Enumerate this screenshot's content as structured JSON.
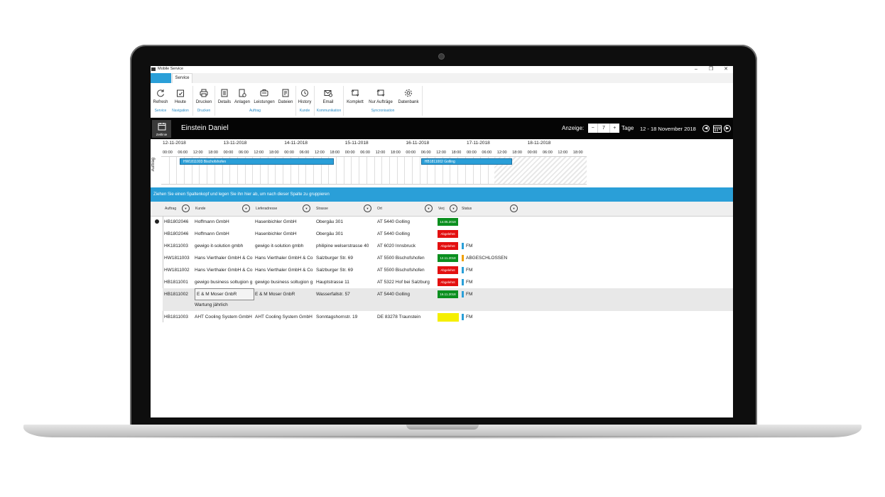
{
  "window": {
    "title": "Mobile Service",
    "controls": [
      "–",
      "❐",
      "✕"
    ]
  },
  "tabs": [
    {
      "label": ""
    },
    {
      "label": "Service"
    }
  ],
  "ribbon": {
    "buttons": [
      {
        "label": "Refresh",
        "icon": "refresh-icon"
      },
      {
        "label": "Heute",
        "icon": "calendar-check-icon"
      },
      {
        "label": "Drucken",
        "icon": "printer-icon"
      },
      {
        "label": "Details",
        "icon": "document-icon"
      },
      {
        "label": "Anlagen",
        "icon": "equipment-icon"
      },
      {
        "label": "Leistungen",
        "icon": "services-icon"
      },
      {
        "label": "Dateien",
        "icon": "files-icon"
      },
      {
        "label": "History",
        "icon": "history-icon"
      },
      {
        "label": "Email",
        "icon": "email-icon"
      },
      {
        "label": "Komplett",
        "icon": "sync-full-icon"
      },
      {
        "label": "Nur Aufträge",
        "icon": "sync-orders-icon"
      },
      {
        "label": "Datenbank",
        "icon": "gear-icon"
      }
    ],
    "groups": [
      "Service",
      "Navigation",
      "Drucken",
      "Auftrag",
      "Kunde",
      "Kommunikation",
      "Syncronisation"
    ]
  },
  "header": {
    "view_label": "Zeitlinie",
    "person": "Einstein Daniel",
    "anzeige_label": "Anzeige:",
    "days_value": "7",
    "minus": "−",
    "plus": "+",
    "tage_label": "Tage",
    "date_range": "12  - 18 November 2018"
  },
  "timeline": {
    "days": [
      "12-11-2018",
      "13-11-2018",
      "14-11-2018",
      "15-11-2018",
      "16-11-2018",
      "17-11-2018",
      "18-11-2018"
    ],
    "hours": [
      "00:00",
      "06:00",
      "12:00",
      "18:00"
    ],
    "row_label": "Auftrag",
    "bars": [
      {
        "label": "HW1811003  Bischofshofen",
        "start_day": 0.28,
        "end_day": 2.82
      },
      {
        "label": "HB1811002  Golling",
        "start_day": 4.25,
        "end_day": 5.75
      }
    ]
  },
  "grid": {
    "group_hint": "Ziehen Sie einen Spaltenkopf und legen Sie ihn hier ab, um nach dieser Spalte zu gruppieren",
    "columns": [
      "Auftrag",
      "Kunde",
      "Lieferadresse",
      "Strasse",
      "Ort",
      "Verj",
      "Status"
    ],
    "rows": [
      {
        "auftrag": "HB1802046",
        "kunde": "Hoffmann GmbH",
        "liefer": "Hasenbichler GmbH",
        "strasse": "Obergäu 301",
        "ort": "AT 5440 Golling",
        "badge": "14.05.2018",
        "badge_color": "#0b8f1f",
        "status_color": "",
        "status": ""
      },
      {
        "auftrag": "HB1802046",
        "kunde": "Hoffmann GmbH",
        "liefer": "Hasenbichler GmbH",
        "strasse": "Obergäu 301",
        "ort": "AT 5440 Golling",
        "badge": "Abgelehnt",
        "badge_color": "#e31010",
        "status_color": "",
        "status": ""
      },
      {
        "auftrag": "HK1811003",
        "kunde": "gewigo it-solution gmbh",
        "liefer": "gewigo it-solution gmbh",
        "strasse": "philipine welserstrasse 40",
        "ort": "AT 6020 Innsbruck",
        "badge": "Abgelehnt",
        "badge_color": "#e31010",
        "status_color": "#2a9fd8",
        "status": "FM"
      },
      {
        "auftrag": "HW1811003",
        "kunde": "Hans Vierthaler GmbH & Co",
        "liefer": "Hans Vierthaler GmbH & Co",
        "strasse": "Salzburger Str. 69",
        "ort": "AT 5500 Bischofshofen",
        "badge": "12.11.2018",
        "badge_color": "#0b8f1f",
        "status_color": "#f0a000",
        "status": "ABGESCHLOSSEN"
      },
      {
        "auftrag": "HW1811002",
        "kunde": "Hans Vierthaler GmbH & Co",
        "liefer": "Hans Vierthaler GmbH & Co",
        "strasse": "Salzburger Str. 69",
        "ort": "AT 5500 Bischofshofen",
        "badge": "Abgelehnt",
        "badge_color": "#e31010",
        "status_color": "#2a9fd8",
        "status": "FM"
      },
      {
        "auftrag": "HB1811001",
        "kunde": "gewigo business soltugion g",
        "liefer": "gewigo business soltugion g",
        "strasse": "Hauptstrasse 11",
        "ort": "AT 5322 Hof bei Salzburg",
        "badge": "Abgelehnt",
        "badge_color": "#e31010",
        "status_color": "#2a9fd8",
        "status": "FM"
      },
      {
        "auftrag": "HB1811002",
        "kunde": "E & M Moser GnbR",
        "liefer": "E & M Moser GnbR",
        "strasse": "Wasserfallstr. 57",
        "ort": "AT 5440 Golling",
        "badge": "16.11.2018",
        "badge_color": "#0b8f1f",
        "status_color": "#2a9fd8",
        "status": "FM"
      },
      {
        "auftrag": "HB1811003",
        "kunde": "AHT Cooling System GmbH",
        "liefer": "AHT Cooling System GmbH",
        "strasse": "Sonntagshornstr. 19",
        "ort": "DE 83278 Traunstein",
        "badge": "",
        "badge_color": "#f5ef00",
        "status_color": "#2a9fd8",
        "status": "FM"
      }
    ],
    "detail_text": "Wartung jährlich"
  }
}
